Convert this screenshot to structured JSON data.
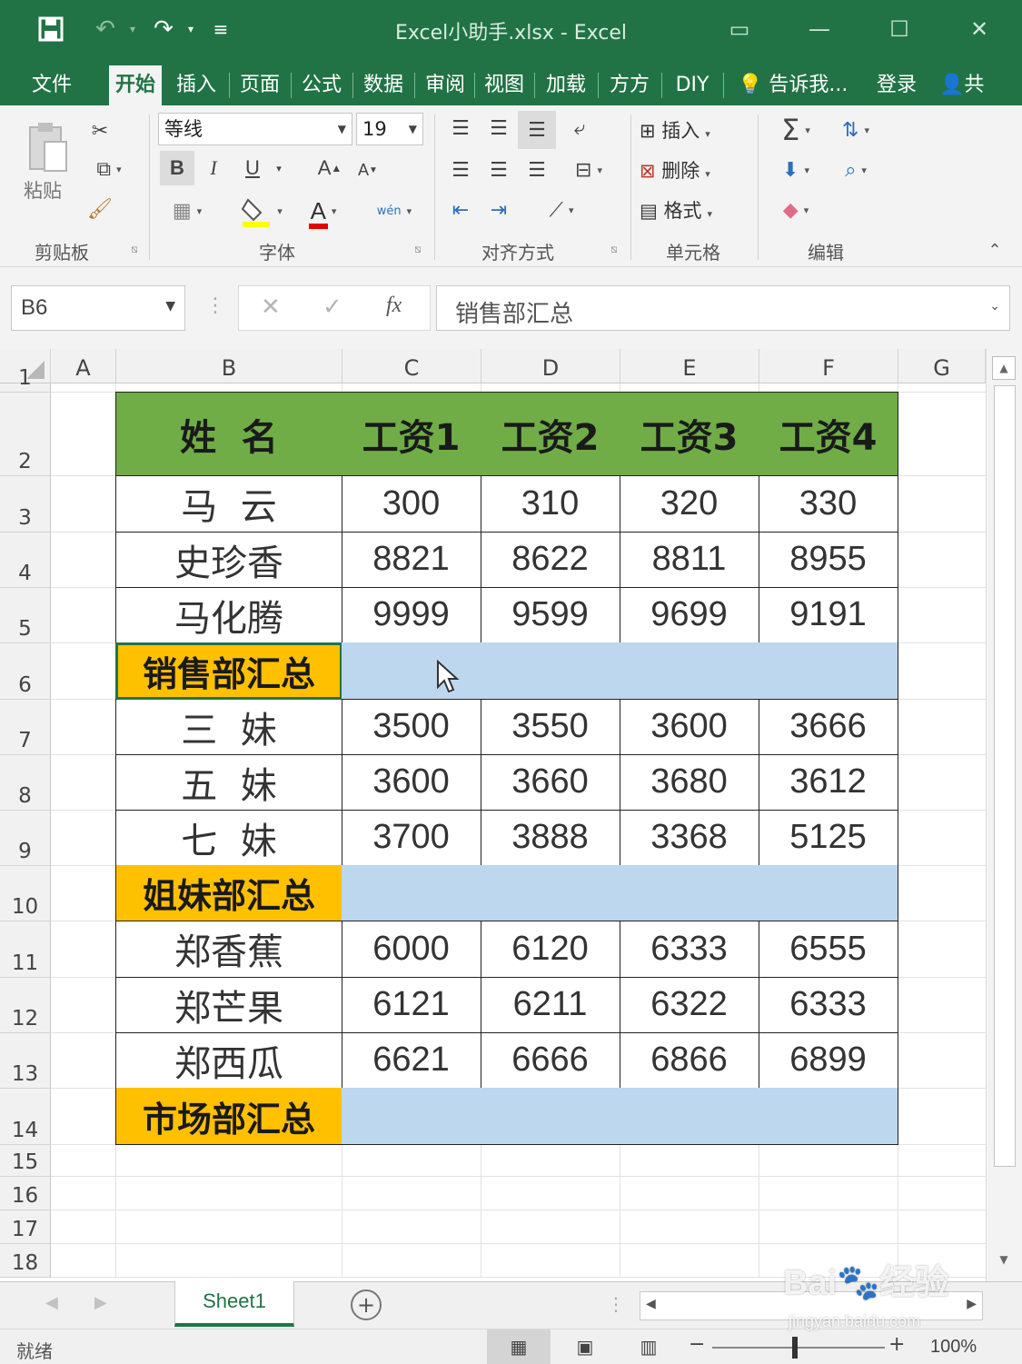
{
  "window": {
    "title": "Excel小助手.xlsx - Excel"
  },
  "tabs": [
    "文件",
    "开始",
    "插入",
    "页面",
    "公式",
    "数据",
    "审阅",
    "视图",
    "加载",
    "方方",
    "DIY",
    "告诉我...",
    "登录",
    "共"
  ],
  "active_tab": "开始",
  "ribbon": {
    "clipboard": {
      "paste_label": "粘贴",
      "group_label": "剪贴板"
    },
    "font": {
      "name": "等线",
      "size": "19",
      "bold": "B",
      "italic": "I",
      "underline": "U",
      "grow": "A",
      "shrink": "A",
      "color_letter": "A",
      "phonetic": "wén",
      "group_label": "字体"
    },
    "alignment": {
      "group_label": "对齐方式"
    },
    "cells": {
      "insert_label": "插入",
      "delete_label": "删除",
      "format_label": "格式",
      "group_label": "单元格"
    },
    "editing": {
      "group_label": "编辑"
    }
  },
  "formula_bar": {
    "name_box": "B6",
    "fx": "fx",
    "content": "销售部汇总"
  },
  "columns": [
    "A",
    "B",
    "C",
    "D",
    "E",
    "F",
    "G"
  ],
  "rows": [
    "1",
    "2",
    "3",
    "4",
    "5",
    "6",
    "7",
    "8",
    "9",
    "10",
    "11",
    "12",
    "13",
    "14",
    "15",
    "16",
    "17",
    "18"
  ],
  "table": {
    "headers": [
      "姓  名",
      "工资1",
      "工资2",
      "工资3",
      "工资4"
    ],
    "body": [
      {
        "kind": "data",
        "name": "马  云",
        "values": [
          "300",
          "310",
          "320",
          "330"
        ]
      },
      {
        "kind": "data",
        "name": "史珍香",
        "values": [
          "8821",
          "8622",
          "8811",
          "8955"
        ]
      },
      {
        "kind": "data",
        "name": "马化腾",
        "values": [
          "9999",
          "9599",
          "9699",
          "9191"
        ]
      },
      {
        "kind": "summary",
        "name": "销售部汇总",
        "values": [
          "",
          "",
          "",
          ""
        ]
      },
      {
        "kind": "data",
        "name": "三  妹",
        "values": [
          "3500",
          "3550",
          "3600",
          "3666"
        ]
      },
      {
        "kind": "data",
        "name": "五  妹",
        "values": [
          "3600",
          "3660",
          "3680",
          "3612"
        ]
      },
      {
        "kind": "data",
        "name": "七  妹",
        "values": [
          "3700",
          "3888",
          "3368",
          "5125"
        ]
      },
      {
        "kind": "summary",
        "name": "姐妹部汇总",
        "values": [
          "",
          "",
          "",
          ""
        ]
      },
      {
        "kind": "data",
        "name": "郑香蕉",
        "values": [
          "6000",
          "6120",
          "6333",
          "6555"
        ]
      },
      {
        "kind": "data",
        "name": "郑芒果",
        "values": [
          "6121",
          "6211",
          "6322",
          "6333"
        ]
      },
      {
        "kind": "data",
        "name": "郑西瓜",
        "values": [
          "6621",
          "6666",
          "6866",
          "6899"
        ]
      },
      {
        "kind": "summary",
        "name": "市场部汇总",
        "values": [
          "",
          "",
          "",
          ""
        ]
      }
    ]
  },
  "sheet_tab": "Sheet1",
  "status": {
    "ready": "就绪",
    "zoom": "100%"
  },
  "watermark": "Baidu经验 jingyan.baidu.com",
  "colors": {
    "excel_green": "#217346",
    "header_fill": "#70ad47",
    "summary_label_fill": "#ffc000",
    "summary_value_fill": "#bdd7ee"
  }
}
